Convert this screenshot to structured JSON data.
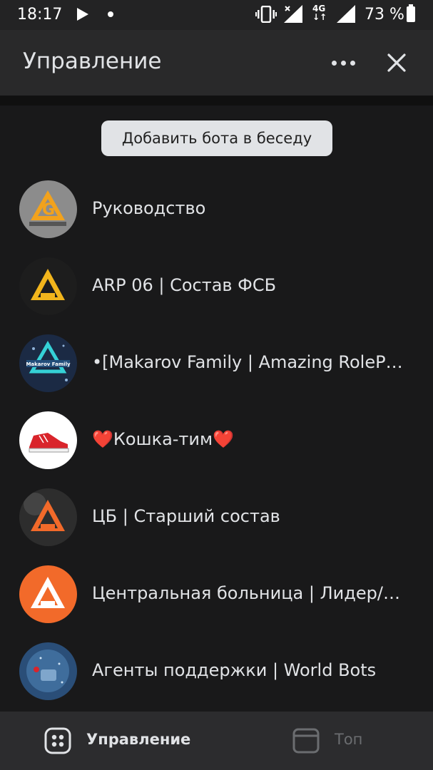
{
  "status_bar": {
    "time": "18:17",
    "network_type": "4G",
    "battery_percent": "73 %"
  },
  "header": {
    "title": "Управление"
  },
  "add_bot_button": "Добавить бота в беседу",
  "chats": [
    {
      "label": "Руководство",
      "avatar_color": "#8c8c8c"
    },
    {
      "label": "ARP 06 | Состав ФСБ",
      "avatar_color": "#1d1d1d"
    },
    {
      "label": "•[Makarov Family | Amazing RolePlay]•",
      "avatar_color": "#1b2a44"
    },
    {
      "label": "❤️Кошка-тим❤️",
      "avatar_color": "#ffffff"
    },
    {
      "label": "ЦБ | Старший состав",
      "avatar_color": "#3a3a3a"
    },
    {
      "label": "Центральная больница | Лидер/Заместители",
      "avatar_color": "#f26a2a"
    },
    {
      "label": "Агенты поддержки | World Bots",
      "avatar_color": "#2a4e78"
    }
  ],
  "bottom_nav": {
    "manage_label": "Управление",
    "top_label": "Топ"
  },
  "colors": {
    "background": "#19191a",
    "header": "#29292a",
    "button": "#e1e3e6",
    "bottom_nav": "#2c2c2e"
  }
}
